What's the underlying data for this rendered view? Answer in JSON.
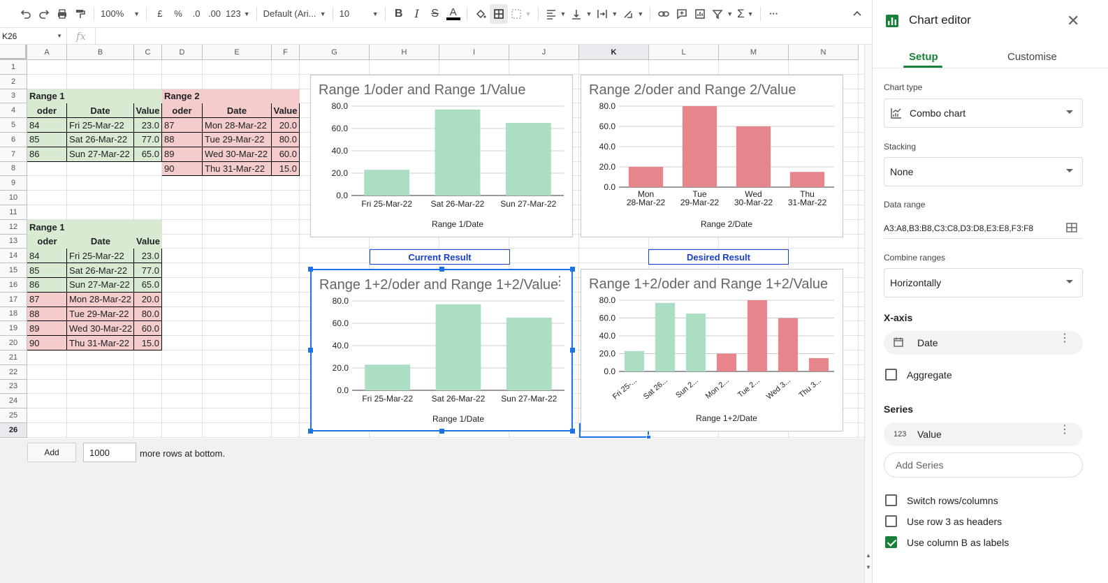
{
  "toolbar": {
    "zoom": "100%",
    "currency": "£",
    "percent": "%",
    "dec_less": ".0",
    "dec_more": ".00",
    "format_more": "123",
    "font": "Default (Ari...",
    "font_size": "10",
    "more": "···"
  },
  "formula_bar": {
    "name_box": "K26",
    "fx": "fx",
    "value": ""
  },
  "columns": [
    "A",
    "B",
    "C",
    "D",
    "E",
    "F",
    "G",
    "H",
    "I",
    "J",
    "K",
    "L",
    "M",
    "N"
  ],
  "rows": [
    "1",
    "2",
    "3",
    "4",
    "5",
    "6",
    "7",
    "8",
    "9",
    "10",
    "11",
    "12",
    "13",
    "14",
    "15",
    "16",
    "17",
    "18",
    "19",
    "20",
    "21",
    "22",
    "23",
    "24",
    "25",
    "26"
  ],
  "range1": {
    "title": "Range 1",
    "headers": [
      "oder",
      "Date",
      "Value"
    ],
    "rows": [
      [
        "84",
        "Fri 25-Mar-22",
        "23.0"
      ],
      [
        "85",
        "Sat 26-Mar-22",
        "77.0"
      ],
      [
        "86",
        "Sun 27-Mar-22",
        "65.0"
      ]
    ]
  },
  "range2": {
    "title": "Range 2",
    "headers": [
      "oder",
      "Date",
      "Value"
    ],
    "rows": [
      [
        "87",
        "Mon 28-Mar-22",
        "20.0"
      ],
      [
        "88",
        "Tue 29-Mar-22",
        "80.0"
      ],
      [
        "89",
        "Wed 30-Mar-22",
        "60.0"
      ],
      [
        "90",
        "Thu 31-Mar-22",
        "15.0"
      ]
    ]
  },
  "combined": {
    "title": "Range 1",
    "headers": [
      "oder",
      "Date",
      "Value"
    ],
    "rows": [
      [
        "84",
        "Fri 25-Mar-22",
        "23.0"
      ],
      [
        "85",
        "Sat 26-Mar-22",
        "77.0"
      ],
      [
        "86",
        "Sun 27-Mar-22",
        "65.0"
      ],
      [
        "87",
        "Mon 28-Mar-22",
        "20.0"
      ],
      [
        "88",
        "Tue 29-Mar-22",
        "80.0"
      ],
      [
        "89",
        "Wed 30-Mar-22",
        "60.0"
      ],
      [
        "90",
        "Thu 31-Mar-22",
        "15.0"
      ]
    ]
  },
  "labels": {
    "current": "Current Result",
    "desired": "Desired Result"
  },
  "colors": {
    "green_bar": "#acdec4",
    "red_bar": "#e6868c",
    "range1_fill": "#d9ead3",
    "range2_fill": "#f4cccc",
    "accent": "#188038",
    "select": "#1a73e8"
  },
  "chart_data": [
    {
      "type": "bar",
      "title": "Range 1/oder and Range 1/Value",
      "xlabel": "Range 1/Date",
      "categories": [
        "Fri 25-Mar-22",
        "Sat 26-Mar-22",
        "Sun 27-Mar-22"
      ],
      "series": [
        {
          "values": [
            23,
            77,
            65
          ],
          "color": "#acdec4"
        }
      ],
      "yticks": [
        "0.0",
        "20.0",
        "40.0",
        "60.0",
        "80.0"
      ],
      "ylim": [
        0,
        80
      ]
    },
    {
      "type": "bar",
      "title": "Range 2/oder and Range 2/Value",
      "xlabel": "Range 2/Date",
      "categories": [
        "Mon 28-Mar-22",
        "Tue 29-Mar-22",
        "Wed 30-Mar-22",
        "Thu 31-Mar-22"
      ],
      "tick_lines": [
        [
          "Mon",
          "28-Mar-22"
        ],
        [
          "Tue",
          "29-Mar-22"
        ],
        [
          "Wed",
          "30-Mar-22"
        ],
        [
          "Thu",
          "31-Mar-22"
        ]
      ],
      "series": [
        {
          "values": [
            20,
            80,
            60,
            15
          ],
          "color": "#e6868c"
        }
      ],
      "yticks": [
        "0.0",
        "20.0",
        "40.0",
        "60.0",
        "80.0"
      ],
      "ylim": [
        0,
        80
      ]
    },
    {
      "type": "bar",
      "title": "Range 1+2/oder and Range 1+2/Value",
      "xlabel": "Range 1/Date",
      "categories": [
        "Fri 25-Mar-22",
        "Sat 26-Mar-22",
        "Sun 27-Mar-22"
      ],
      "series": [
        {
          "values": [
            23,
            77,
            65
          ],
          "color": "#acdec4"
        }
      ],
      "yticks": [
        "0.0",
        "20.0",
        "40.0",
        "60.0",
        "80.0"
      ],
      "ylim": [
        0,
        80
      ]
    },
    {
      "type": "bar",
      "title": "Range 1+2/oder and Range 1+2/Value",
      "xlabel": "Range 1+2/Date",
      "categories": [
        "Fri 25-...",
        "Sat 26...",
        "Sun 2...",
        "Mon 2...",
        "Tue 2...",
        "Wed 3...",
        "Thu 3..."
      ],
      "series": [
        {
          "values": [
            23,
            77,
            65,
            20,
            80,
            60,
            15
          ],
          "colors": [
            "#acdec4",
            "#acdec4",
            "#acdec4",
            "#e6868c",
            "#e6868c",
            "#e6868c",
            "#e6868c"
          ]
        }
      ],
      "yticks": [
        "0.0",
        "20.0",
        "40.0",
        "60.0",
        "80.0"
      ],
      "ylim": [
        0,
        80
      ]
    }
  ],
  "add_rows": {
    "button": "Add",
    "count": "1000",
    "text": "more rows at bottom."
  },
  "panel": {
    "title": "Chart editor",
    "tabs": [
      "Setup",
      "Customise"
    ],
    "chart_type_label": "Chart type",
    "chart_type": "Combo chart",
    "stacking_label": "Stacking",
    "stacking": "None",
    "data_range_label": "Data range",
    "data_range": "A3:A8,B3:B8,C3:C8,D3:D8,E3:E8,F3:F8",
    "combine_label": "Combine ranges",
    "combine": "Horizontally",
    "xaxis_head": "X-axis",
    "xaxis_value": "Date",
    "aggregate": "Aggregate",
    "series_head": "Series",
    "series_icon": "123",
    "series_value": "Value",
    "add_series": "Add Series",
    "switch_rows": "Switch rows/columns",
    "use_row3": "Use row 3 as headers",
    "use_colB": "Use column B as labels"
  }
}
